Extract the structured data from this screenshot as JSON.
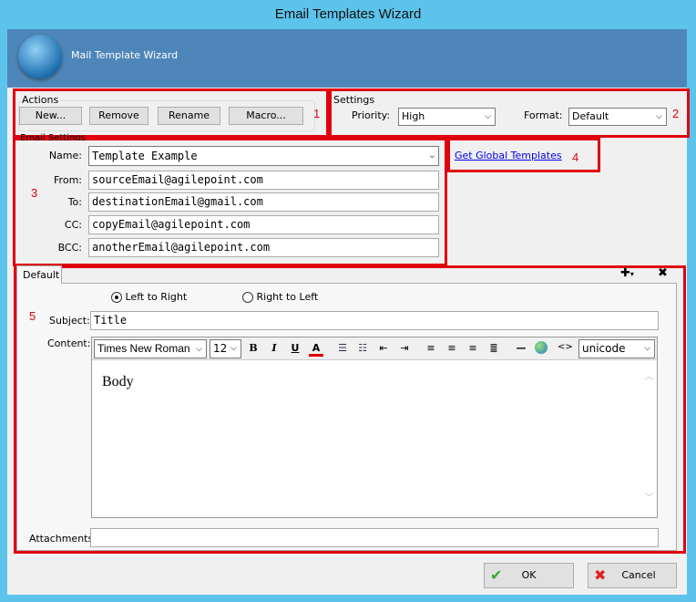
{
  "window": {
    "title": "Email Templates Wizard"
  },
  "header": {
    "title": "Mail Template Wizard"
  },
  "actions": {
    "label": "Actions",
    "buttons": [
      "New...",
      "Remove",
      "Rename",
      "Macro..."
    ],
    "annotation": "1"
  },
  "settings": {
    "label": "Settings",
    "priority_label": "Priority:",
    "priority_value": "High",
    "format_label": "Format:",
    "format_value": "Default",
    "annotation": "2"
  },
  "email_settings": {
    "label": "Email Settings",
    "annotation": "3",
    "name_label": "Name:",
    "name_value": "Template Example",
    "from_label": "From:",
    "from_value": "sourceEmail@agilepoint.com",
    "to_label": "To:",
    "to_value": "destinationEmail@gmail.com",
    "cc_label": "CC:",
    "cc_value": "copyEmail@agilepoint.com",
    "bcc_label": "BCC:",
    "bcc_value": "anotherEmail@agilepoint.com"
  },
  "global": {
    "link": "Get Global Templates",
    "annotation": "4"
  },
  "editor": {
    "annotation": "5",
    "tab": "Default",
    "ltr": "Left to Right",
    "rtl": "Right to Left",
    "direction": "Left to Right",
    "subject_label": "Subject:",
    "subject_value": "Title",
    "content_label": "Content:",
    "font": "Times New Roman",
    "size": "12",
    "encoding": "unicode",
    "body": "Body",
    "attachments_label": "Attachments:",
    "attachments_value": ""
  },
  "footer": {
    "ok": "OK",
    "cancel": "Cancel"
  },
  "colors": {
    "annotation": "#e00010",
    "header": "#4f86b9",
    "frame": "#5cc3ea"
  }
}
